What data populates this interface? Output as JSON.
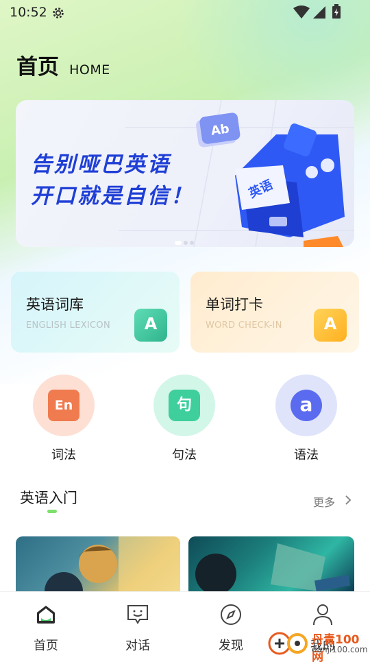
{
  "status_bar": {
    "time": "10:52",
    "icons": [
      "gear-icon",
      "wifi-icon",
      "signal-icon",
      "battery-icon"
    ]
  },
  "header": {
    "title": "首页",
    "subtitle": "HOME"
  },
  "banner": {
    "line1": "告别哑巴英语",
    "line2": "开口就是自信！",
    "accent_color": "#1f3fd6"
  },
  "feature_cards": [
    {
      "title": "英语词库",
      "subtitle": "ENGLISH LEXICON",
      "icon": "book-icon",
      "icon_glyph": "A"
    },
    {
      "title": "单词打卡",
      "subtitle": "WORD CHECK-IN",
      "icon": "letter-a-icon",
      "icon_glyph": "A"
    }
  ],
  "categories": [
    {
      "label": "词法",
      "icon": "en-icon",
      "glyph": "En"
    },
    {
      "label": "句法",
      "icon": "sentence-icon",
      "glyph": "句"
    },
    {
      "label": "语法",
      "icon": "grammar-icon",
      "glyph": "a"
    }
  ],
  "section": {
    "title": "英语入门",
    "more_label": "更多"
  },
  "tabbar": {
    "items": [
      {
        "label": "首页",
        "icon": "home-icon"
      },
      {
        "label": "对话",
        "icon": "chat-icon"
      },
      {
        "label": "发现",
        "icon": "compass-icon"
      },
      {
        "label": "我的",
        "icon": "profile-icon"
      }
    ]
  },
  "watermark": {
    "brand": "丹青100网",
    "url": "danji100.com"
  }
}
